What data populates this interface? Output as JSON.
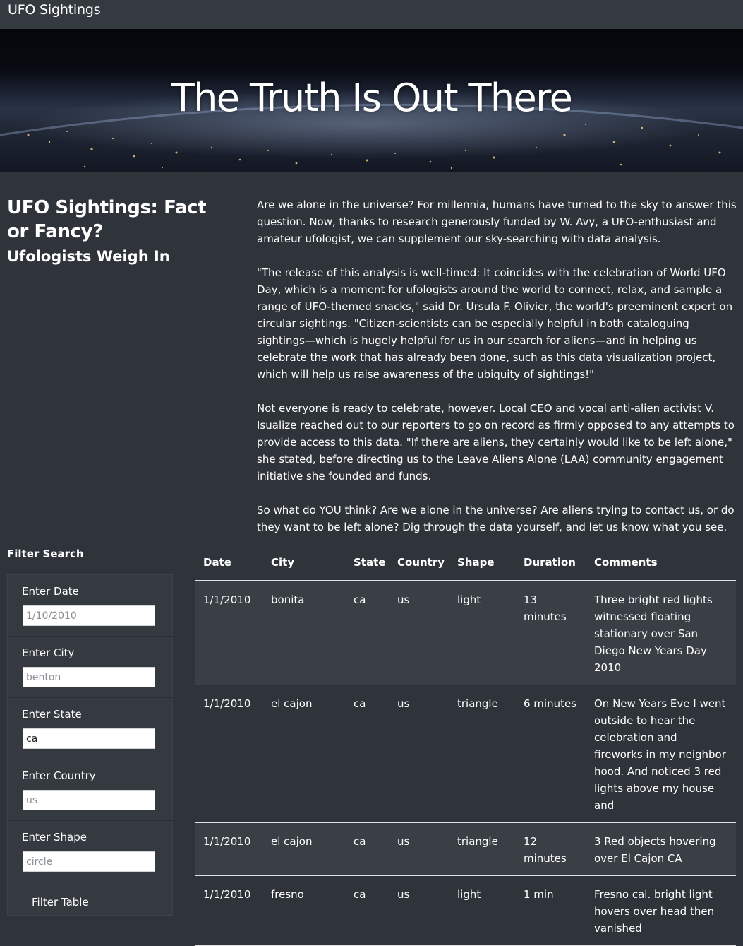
{
  "navbar": {
    "brand": "UFO Sightings"
  },
  "hero": {
    "title": "The Truth Is Out There"
  },
  "intro": {
    "headline": "UFO Sightings: Fact or Fancy?",
    "subheadline": "Ufologists Weigh In"
  },
  "article": {
    "paragraphs": [
      "Are we alone in the universe? For millennia, humans have turned to the sky to answer this question. Now, thanks to research generously funded by W. Avy, a UFO-enthusiast and amateur ufologist, we can supplement our sky-searching with data analysis.",
      "\"The release of this analysis is well-timed: It coincides with the celebration of World UFO Day, which is a moment for ufologists around the world to connect, relax, and sample a range of UFO-themed snacks,\" said Dr. Ursula F. Olivier, the world's preeminent expert on circular sightings. \"Citizen-scientists can be especially helpful in both cataloguing sightings—which is hugely helpful for us in our search for aliens—and in helping us celebrate the work that has already been done, such as this data visualization project, which will help us raise awareness of the ubiquity of sightings!\"",
      "Not everyone is ready to celebrate, however. Local CEO and vocal anti-alien activist V. Isualize reached out to our reporters to go on record as firmly opposed to any attempts to provide access to this data. \"If there are aliens, they certainly would like to be left alone,\" she stated, before directing us to the Leave Aliens Alone (LAA) community engagement initiative she founded and funds.",
      "So what do YOU think? Are we alone in the universe? Are aliens trying to contact us, or do they want to be left alone? Dig through the data yourself, and let us know what you see."
    ]
  },
  "filters": {
    "title": "Filter Search",
    "date": {
      "label": "Enter Date",
      "placeholder": "1/10/2010",
      "value": ""
    },
    "city": {
      "label": "Enter City",
      "placeholder": "benton",
      "value": ""
    },
    "state": {
      "label": "Enter State",
      "placeholder": "ca",
      "value": "ca"
    },
    "country": {
      "label": "Enter Country",
      "placeholder": "us",
      "value": ""
    },
    "shape": {
      "label": "Enter Shape",
      "placeholder": "circle",
      "value": ""
    },
    "button_label": "Filter Table"
  },
  "table": {
    "headers": {
      "date": "Date",
      "city": "City",
      "state": "State",
      "country": "Country",
      "shape": "Shape",
      "duration": "Duration",
      "comments": "Comments"
    },
    "rows": [
      {
        "date": "1/1/2010",
        "city": "bonita",
        "state": "ca",
        "country": "us",
        "shape": "light",
        "duration": "13 minutes",
        "comments": "Three bright red lights witnessed floating stationary over San Diego New Years Day 2010"
      },
      {
        "date": "1/1/2010",
        "city": "el cajon",
        "state": "ca",
        "country": "us",
        "shape": "triangle",
        "duration": "6 minutes",
        "comments": "On New Years Eve I went outside to hear the celebration and fireworks in my neighbor hood. And noticed 3 red lights above my house and"
      },
      {
        "date": "1/1/2010",
        "city": "el cajon",
        "state": "ca",
        "country": "us",
        "shape": "triangle",
        "duration": "12 minutes",
        "comments": "3 Red objects hovering over El Cajon CA"
      },
      {
        "date": "1/1/2010",
        "city": "fresno",
        "state": "ca",
        "country": "us",
        "shape": "light",
        "duration": "1 min",
        "comments": "Fresno cal. bright light hovers over head then vanished"
      }
    ]
  },
  "colors": {
    "background": "#2f343b",
    "navbar": "#343a40",
    "text": "#ffffff"
  }
}
